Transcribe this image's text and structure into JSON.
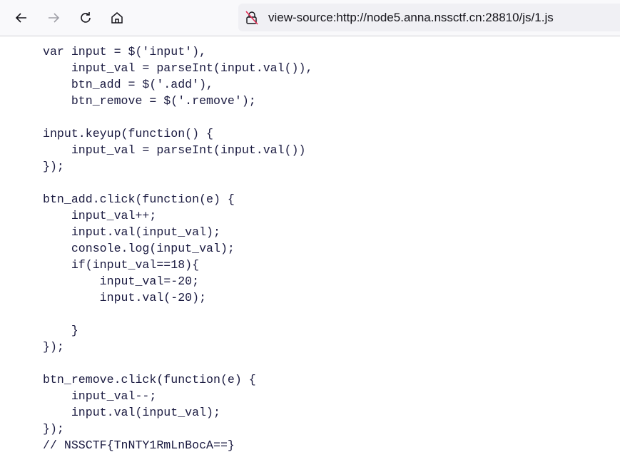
{
  "browser": {
    "url": "view-source:http://node5.anna.nssctf.cn:28810/js/1.js",
    "icons": [
      "back-icon",
      "forward-icon",
      "reload-icon",
      "home-icon",
      "insecure-lock-icon"
    ]
  },
  "source": {
    "lines": [
      "var input = $('input'),",
      "    input_val = parseInt(input.val()),",
      "    btn_add = $('.add'),",
      "    btn_remove = $('.remove');",
      "",
      "input.keyup(function() {",
      "    input_val = parseInt(input.val())",
      "});",
      "",
      "btn_add.click(function(e) {",
      "    input_val++;",
      "    input.val(input_val);",
      "    console.log(input_val);",
      "    if(input_val==18){",
      "        input_val=-20;",
      "        input.val(-20);",
      "",
      "    }",
      "});",
      "",
      "btn_remove.click(function(e) {",
      "    input_val--;",
      "    input.val(input_val);",
      "});",
      "// NSSCTF{TnNTY1RmLnBocA==}"
    ]
  }
}
